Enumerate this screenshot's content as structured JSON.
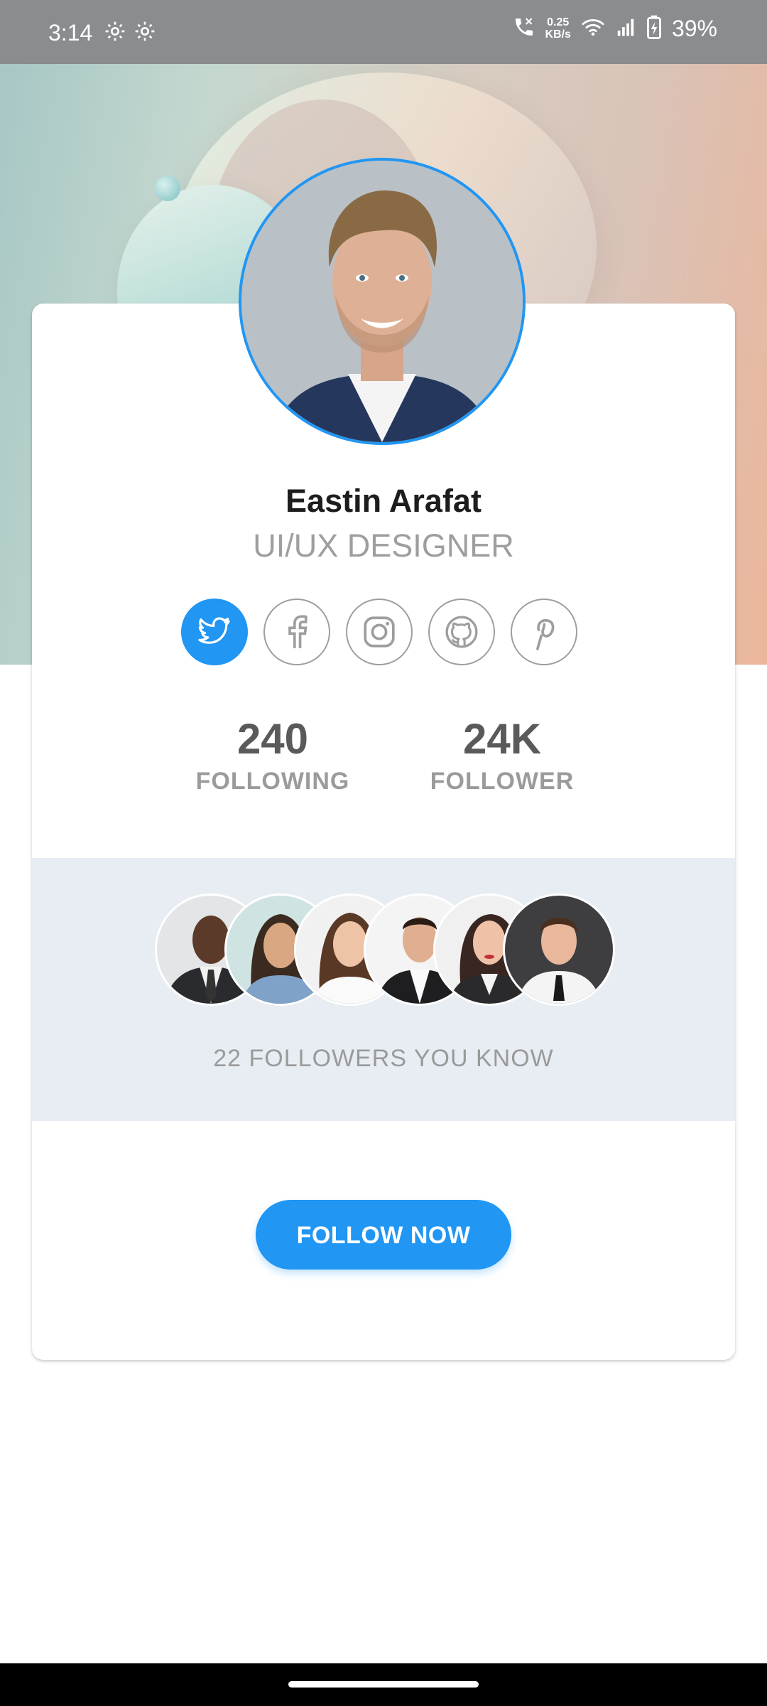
{
  "status_bar": {
    "time": "3:14",
    "net_speed_value": "0.25",
    "net_speed_unit": "KB/s",
    "battery": "39%",
    "icons": [
      "settings-gear-icon",
      "settings-gear-icon",
      "call-icon",
      "wifi-icon",
      "signal-icon",
      "battery-charging-icon"
    ]
  },
  "profile": {
    "name": "Eastin Arafat",
    "title": "UI/UX DESIGNER",
    "social": [
      {
        "icon": "twitter-icon",
        "active": true
      },
      {
        "icon": "facebook-icon",
        "active": false
      },
      {
        "icon": "instagram-icon",
        "active": false
      },
      {
        "icon": "github-icon",
        "active": false
      },
      {
        "icon": "pinterest-icon",
        "active": false
      }
    ],
    "stats": {
      "following_value": "240",
      "following_label": "FOLLOWING",
      "follower_value": "24K",
      "follower_label": "FOLLOWER"
    }
  },
  "followers_panel": {
    "caption": "22 FOLLOWERS YOU KNOW",
    "avatar_count": 6
  },
  "actions": {
    "follow_label": "FOLLOW NOW"
  },
  "colors": {
    "accent": "#2196f3",
    "panel_bg": "#e8edf4",
    "name_text": "#1d1d1f",
    "muted_text": "#9e9e9e"
  }
}
